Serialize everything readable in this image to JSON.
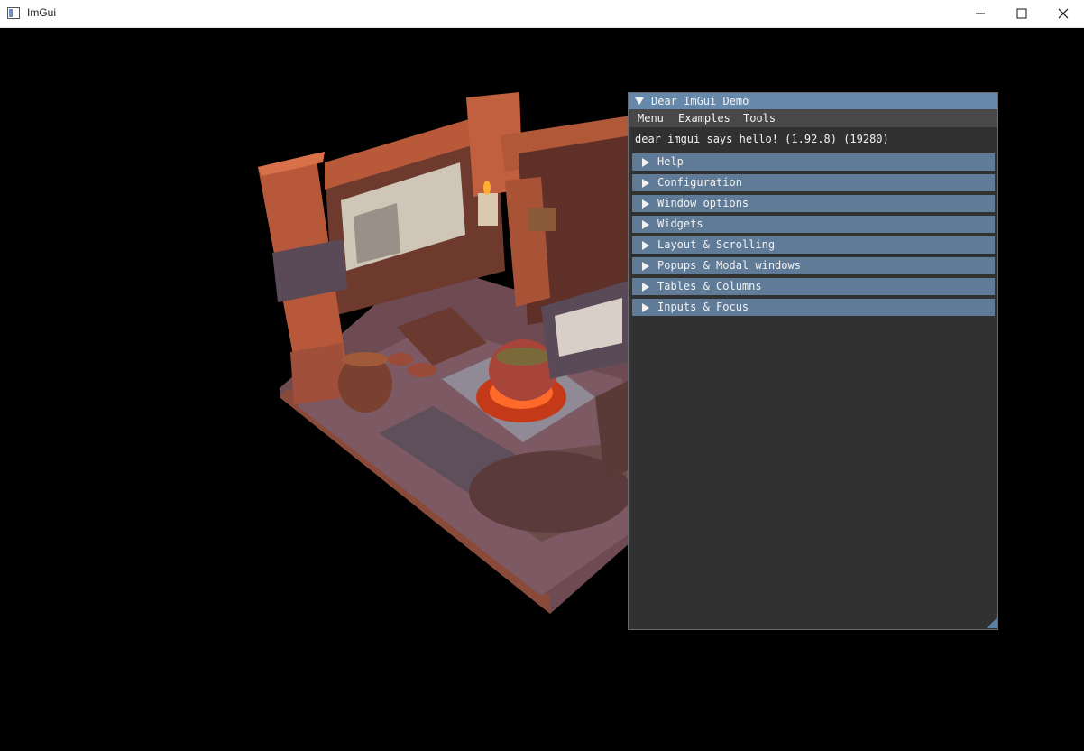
{
  "window": {
    "title": "ImGui"
  },
  "demo": {
    "title": "Dear ImGui Demo",
    "menus": [
      "Menu",
      "Examples",
      "Tools"
    ],
    "hello": "dear imgui says hello! (1.92.8) (19280)",
    "headers": [
      {
        "label": "Help"
      },
      {
        "label": "Configuration"
      },
      {
        "label": "Window options"
      },
      {
        "label": "Widgets"
      },
      {
        "label": "Layout & Scrolling"
      },
      {
        "label": "Popups & Modal windows"
      },
      {
        "label": "Tables & Columns"
      },
      {
        "label": "Inputs & Focus"
      }
    ]
  },
  "colors": {
    "title_bar": "#6688aa",
    "header": "#5f7b97",
    "window_bg": "#343434",
    "menu_bar": "#484848"
  }
}
